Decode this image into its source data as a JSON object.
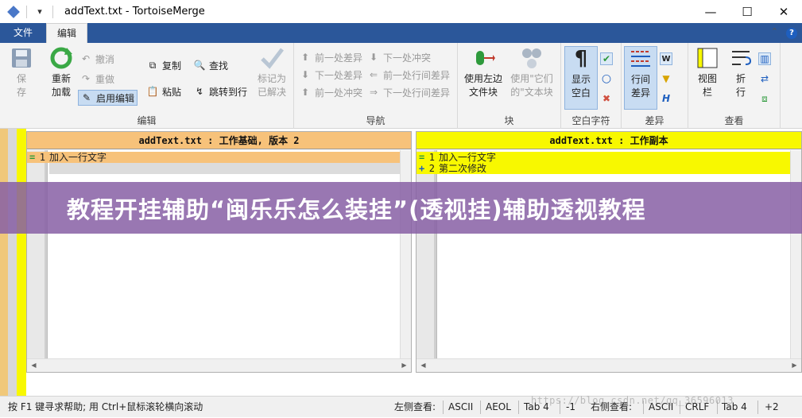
{
  "window": {
    "title": "addText.txt - TortoiseMerge",
    "quick_access": "▾",
    "controls": {
      "minimize": "—",
      "maximize": "☐",
      "close": "✕"
    }
  },
  "ribbon_tabs": {
    "file": "文件",
    "edit": "编辑"
  },
  "ribbon": {
    "edit_group": {
      "label": "编辑",
      "save": [
        "保",
        "存"
      ],
      "reload": [
        "重新",
        "加载"
      ],
      "undo": "撤消",
      "redo": "重做",
      "enable_edit": "启用编辑",
      "copy": "复制",
      "paste": "粘贴",
      "find": "查找",
      "goto_line": "跳转到行",
      "mark_resolved": [
        "标记为",
        "已解决"
      ]
    },
    "nav_group": {
      "label": "导航",
      "prev_diff": "前一处差异",
      "next_diff": "下一处差异",
      "prev_conflict": "前一处冲突",
      "next_conflict": "下一处冲突",
      "prev_inline_diff": "前一处行间差异",
      "next_inline_diff": "下一处行间差异"
    },
    "block_group": {
      "label": "块",
      "use_left": [
        "使用左边",
        "文件块"
      ],
      "use_their": [
        "使用\"它们",
        "的\"文本块"
      ]
    },
    "whitespace_group": {
      "label": "空白字符",
      "show_ws": [
        "显示",
        "空白"
      ]
    },
    "diff_group": {
      "label": "差异",
      "inline_diff": [
        "行间",
        "差异"
      ]
    },
    "view_group": {
      "label": "查看",
      "view_bar": [
        "视图",
        "栏"
      ],
      "wrap": [
        "折",
        "行"
      ]
    }
  },
  "left_pane": {
    "header": "addText.txt : 工作基础, 版本 2",
    "lines": [
      {
        "num": "1",
        "mark": "=",
        "text": "加入一行文字"
      }
    ]
  },
  "right_pane": {
    "header": "addText.txt : 工作副本",
    "lines": [
      {
        "num": "1",
        "mark": "=",
        "text": "加入一行文字"
      },
      {
        "num": "2",
        "mark": "+",
        "text": "第二次修改"
      }
    ]
  },
  "banner": {
    "text": "教程开挂辅助“闽乐乐怎么装挂”(透视挂)辅助透视教程"
  },
  "status": {
    "help": "按 F1 键寻求帮助; 用 Ctrl+鼠标滚轮横向滚动",
    "left_view": "左侧查看:",
    "left_encoding": "ASCII",
    "left_eol": "AEOL",
    "left_tab": "Tab 4",
    "left_count": "-1",
    "right_view": "右侧查看:",
    "right_encoding": "ASCII",
    "right_eol": "CRLF",
    "right_tab": "Tab 4",
    "right_count": "+2"
  },
  "watermark": "https://blog.csdn.net/qq_36596013",
  "colors": {
    "ribbon_blue": "#2b579a",
    "base_header": "#f7c27a",
    "mine_header": "#f8f800",
    "banner": "#875fa5"
  }
}
